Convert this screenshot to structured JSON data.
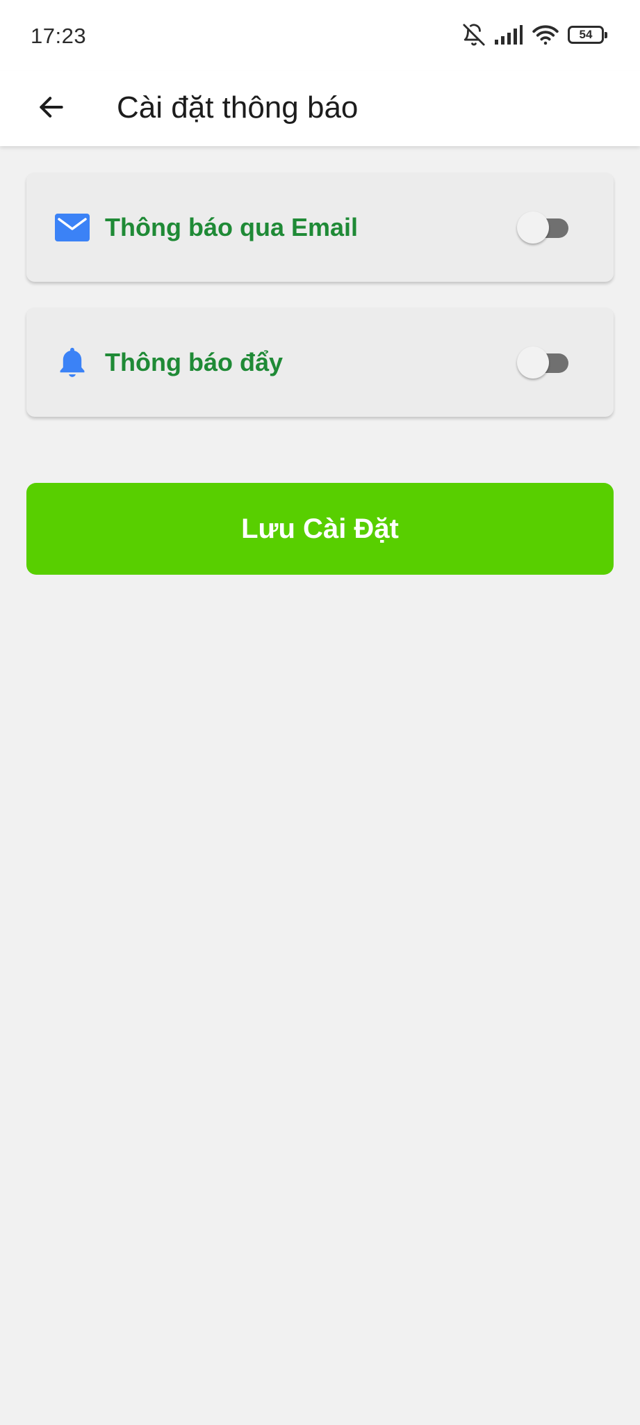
{
  "status_bar": {
    "time": "17:23",
    "battery_level": "54",
    "icons": [
      "bell-off-icon",
      "signal-icon",
      "wifi-icon",
      "battery-icon"
    ]
  },
  "app_bar": {
    "title": "Cài đặt thông báo",
    "back_icon": "arrow-left-icon"
  },
  "settings": {
    "items": [
      {
        "label": "Thông báo qua Email",
        "icon": "mail-icon",
        "enabled": false
      },
      {
        "label": "Thông báo đẩy",
        "icon": "bell-icon",
        "enabled": false
      }
    ]
  },
  "actions": {
    "save_label": "Lưu Cài Đặt"
  },
  "colors": {
    "label_green": "#1f8a36",
    "button_green": "#58cf00",
    "icon_blue": "#3b82f6",
    "background": "#f1f1f1",
    "toggle_off_track": "#707070"
  }
}
